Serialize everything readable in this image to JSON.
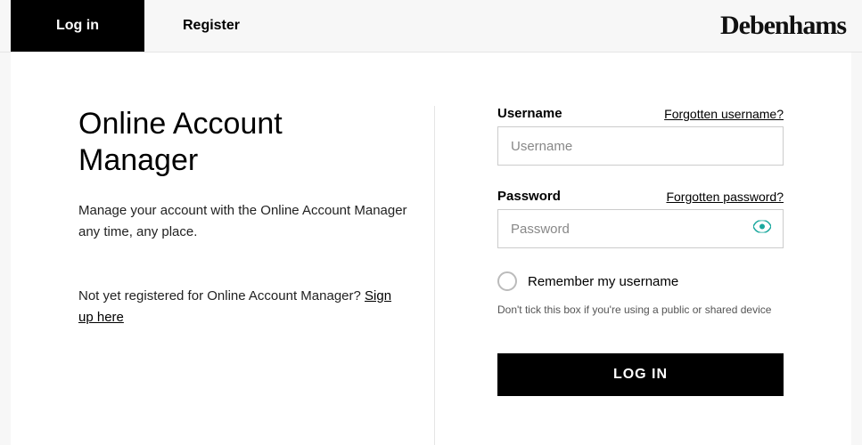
{
  "tabs": {
    "login": "Log in",
    "register": "Register"
  },
  "brand": "Debenhams",
  "left": {
    "heading": "Online Account Manager",
    "intro": "Manage your account with the Online Account Manager any time, any place.",
    "signup_prefix": "Not yet registered for Online Account Manager? ",
    "signup_link": "Sign up here"
  },
  "form": {
    "username_label": "Username",
    "forgot_username": "Forgotten username?",
    "username_placeholder": "Username",
    "password_label": "Password",
    "forgot_password": "Forgotten password?",
    "password_placeholder": "Password",
    "remember_label": "Remember my username",
    "hint": "Don't tick this box if you're using a public or shared device",
    "submit_label": "LOG IN"
  }
}
